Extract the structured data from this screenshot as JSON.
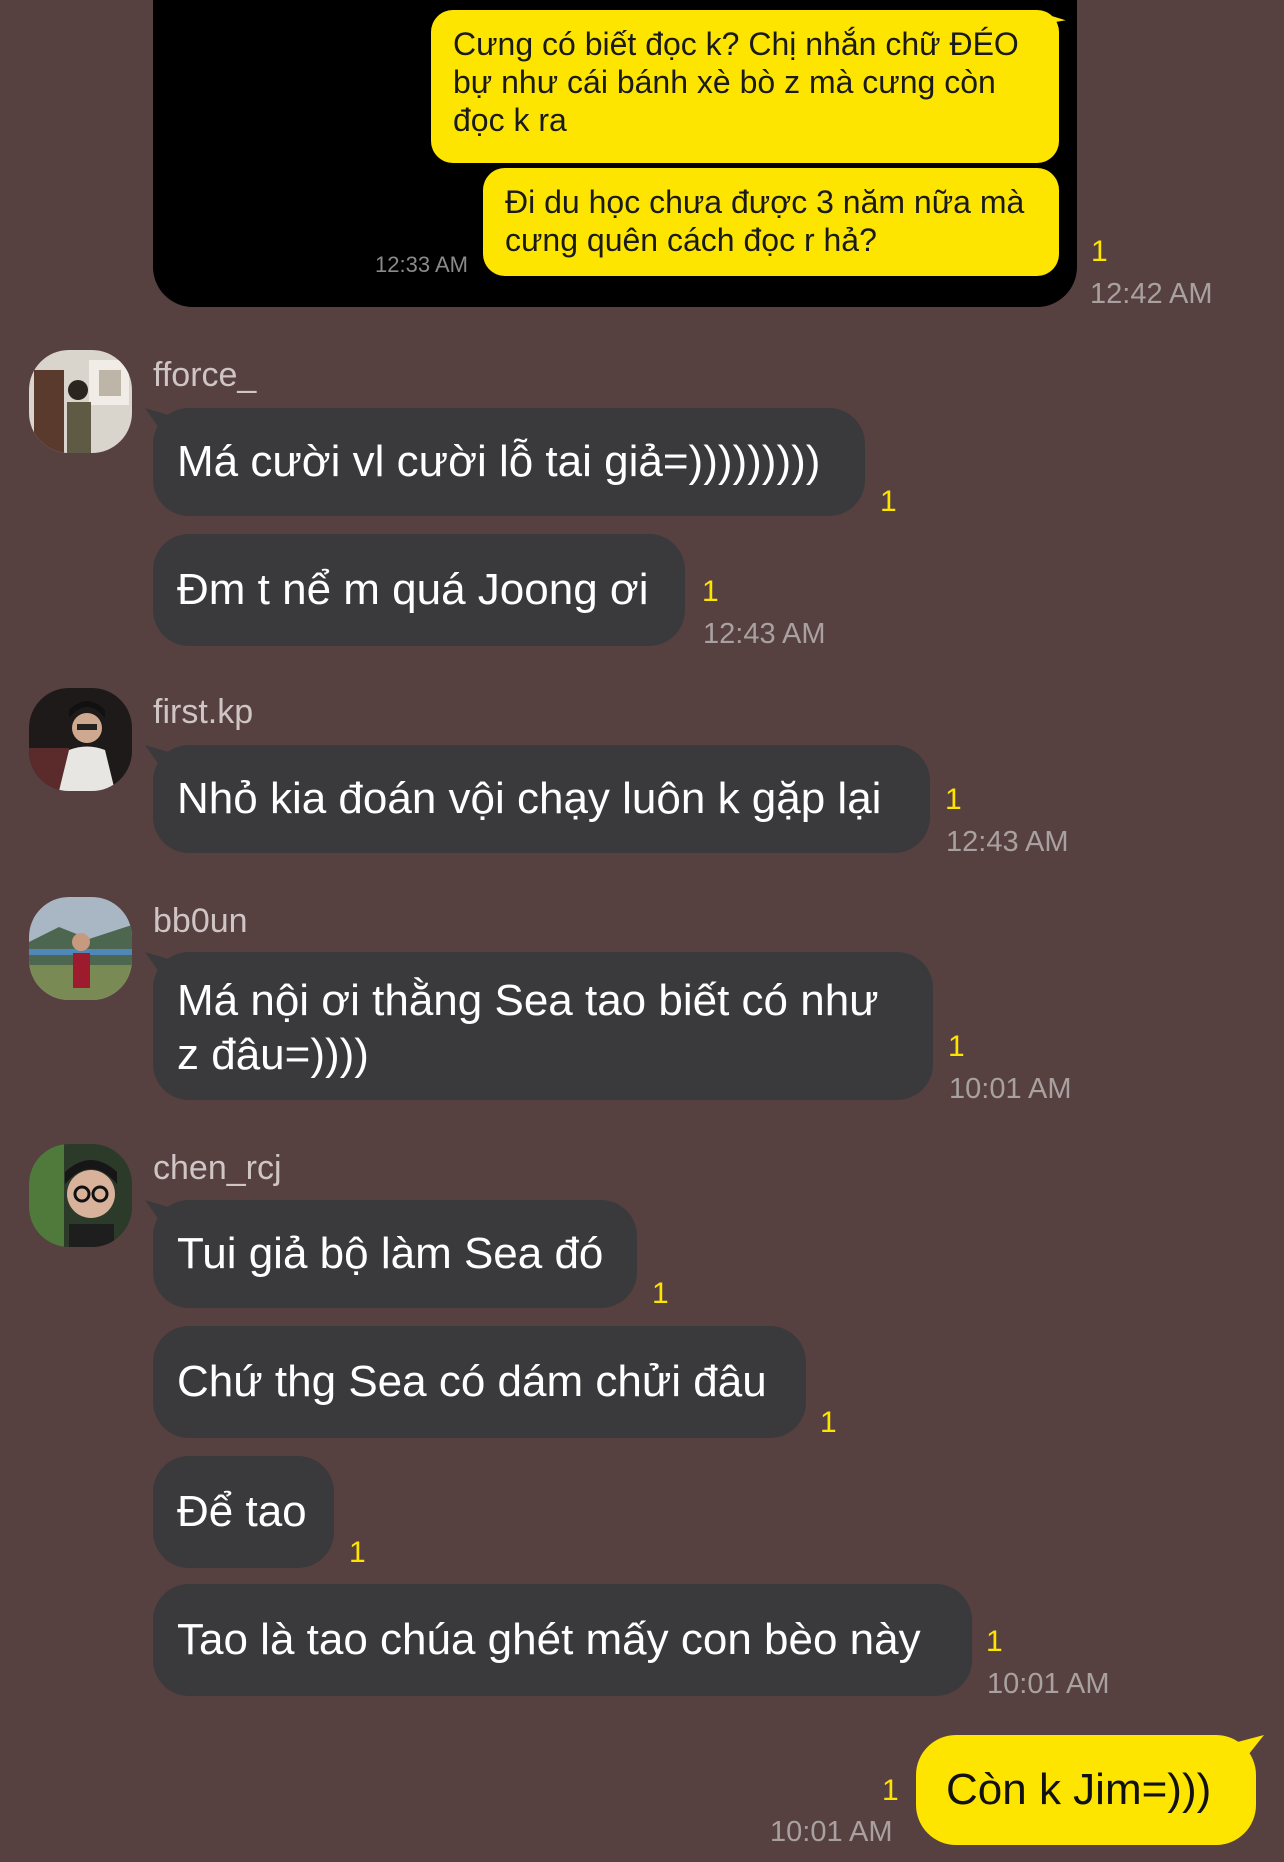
{
  "quoted_image": {
    "bubble1": "Cưng có biết đọc k? Chị nhắn chữ ĐÉO bự như cái bánh xè bò z mà cưng còn đọc k ra",
    "bubble2": "Đi du học chưa được 3 năm nữa mà cưng quên cách đọc r hả?",
    "time": "12:33 AM"
  },
  "outgoing_top": {
    "unread": "1",
    "time": "12:42 AM"
  },
  "groups": [
    {
      "username": "fforce_",
      "messages": [
        {
          "text": "Má cười vl cười lỗ tai giả=)))))))))",
          "unread": "1"
        },
        {
          "text": "Đm t nể m quá Joong ơi",
          "unread": "1",
          "time": "12:43 AM"
        }
      ]
    },
    {
      "username": "first.kp",
      "messages": [
        {
          "text": "Nhỏ kia đoán vội chạy luôn k gặp lại",
          "unread": "1",
          "time": "12:43 AM"
        }
      ]
    },
    {
      "username": "bb0un",
      "messages": [
        {
          "text": "Má nội ơi thằng Sea tao biết có như z đâu=))))",
          "unread": "1",
          "time": "10:01 AM"
        }
      ]
    },
    {
      "username": "chen_rcj",
      "messages": [
        {
          "text": "Tui giả bộ làm Sea đó",
          "unread": "1"
        },
        {
          "text": "Chứ thg Sea có dám chửi đâu",
          "unread": "1"
        },
        {
          "text": "Để tao",
          "unread": "1"
        },
        {
          "text": "Tao là tao chúa ghét mấy con bèo này",
          "unread": "1",
          "time": "10:01 AM"
        }
      ]
    }
  ],
  "outgoing_bottom": {
    "text": "Còn k Jim=)))",
    "unread": "1",
    "time": "10:01 AM"
  }
}
